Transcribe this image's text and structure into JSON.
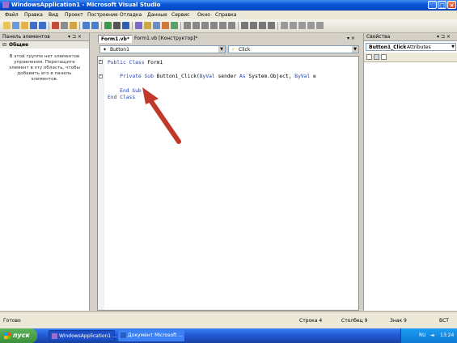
{
  "window": {
    "title": "WindowsApplication1 - Microsoft Visual Studio",
    "minimize": "_",
    "maximize": "□",
    "close": "×"
  },
  "menu": [
    "Файл",
    "Правка",
    "Вид",
    "Проект",
    "Построение",
    "Отладка",
    "Данные",
    "Сервис",
    "Окно",
    "Справка"
  ],
  "toolbox": {
    "title": "Панель элементов",
    "pin": "▾ ⊐ ×",
    "group_label": "Общие",
    "empty_text": "В этой группе нет элементов управления. Перетащите элемент в эту область, чтобы добавить его в панель элементов."
  },
  "editor": {
    "tabs": [
      {
        "label": "Form1.vb*",
        "active": true
      },
      {
        "label": "Form1.vb [Конструктор]*",
        "active": false
      }
    ],
    "tab_controls": "▾ ×",
    "object_combo": "Button1",
    "event_combo": "Click",
    "code_lines": [
      {
        "parts": [
          {
            "t": "Public Class ",
            "k": true
          },
          {
            "t": "Form1",
            "k": false
          }
        ]
      },
      {
        "parts": []
      },
      {
        "parts": [
          {
            "t": "    Private Sub ",
            "k": true
          },
          {
            "t": "Button1_Click(",
            "k": false
          },
          {
            "t": "ByVal ",
            "k": true
          },
          {
            "t": "sender ",
            "k": false
          },
          {
            "t": "As ",
            "k": true
          },
          {
            "t": "System.Object, ",
            "k": false
          },
          {
            "t": "ByVal ",
            "k": true
          },
          {
            "t": "e",
            "k": false
          }
        ]
      },
      {
        "parts": []
      },
      {
        "parts": [
          {
            "t": "    End Sub",
            "k": true
          }
        ]
      },
      {
        "parts": [
          {
            "t": "End Class",
            "k": true
          }
        ]
      }
    ]
  },
  "properties": {
    "title": "Свойства",
    "controls": "▾ ⊐ ×",
    "selected_object": "Button1_Click",
    "selected_type": "Attributes"
  },
  "status": {
    "text": "Готово",
    "line": "Строка 4",
    "column": "Столбец 9",
    "char": "Знак 9",
    "mode": "ВСТ"
  },
  "taskbar": {
    "start": "пуск",
    "tasks": [
      {
        "label": "WindowsApplication1 ..."
      },
      {
        "label": "Документ Microsoft ..."
      }
    ],
    "lang": "RU",
    "clock": "13:24"
  },
  "colors": {
    "keyword": "#1f3fb3",
    "arrow": "#c0392b",
    "title_bar": "#0a56d8"
  }
}
